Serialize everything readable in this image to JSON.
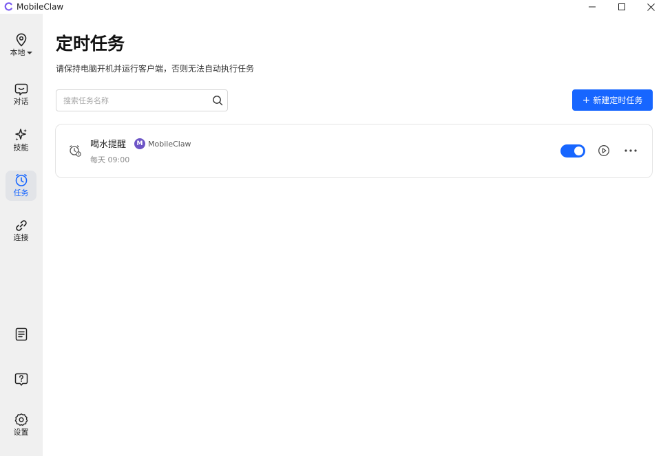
{
  "app": {
    "title": "MobileClaw"
  },
  "window_controls": {
    "minimize_icon": "minimize-icon",
    "maximize_icon": "maximize-icon",
    "close_icon": "close-icon"
  },
  "sidebar": {
    "location": {
      "label": "本地",
      "icon": "location-pin-icon"
    },
    "items": [
      {
        "label": "对话",
        "icon": "chat-icon",
        "active": false
      },
      {
        "label": "技能",
        "icon": "sparkle-icon",
        "active": false
      },
      {
        "label": "任务",
        "icon": "clock-icon",
        "active": true
      },
      {
        "label": "连接",
        "icon": "link-icon",
        "active": false
      }
    ],
    "bottom": {
      "docs_icon": "document-icon",
      "help_icon": "help-icon",
      "settings": {
        "label": "设置",
        "icon": "gear-icon"
      }
    }
  },
  "page": {
    "title": "定时任务",
    "subtitle": "请保持电脑开机并运行客户端，否则无法自动执行任务"
  },
  "search": {
    "placeholder": "搜索任务名称",
    "value": ""
  },
  "new_task_button": {
    "label": "新建定时任务",
    "icon": "plus-icon"
  },
  "tasks": [
    {
      "name": "喝水提醒",
      "agent": {
        "name": "MobileClaw",
        "avatar_letter": "M"
      },
      "schedule": "每天 09:00",
      "enabled": true
    }
  ],
  "colors": {
    "accent": "#1766ff",
    "sidebar_bg": "#f0f0f0",
    "active_nav_bg": "#e2e4e8",
    "avatar": "#6d55c6"
  }
}
